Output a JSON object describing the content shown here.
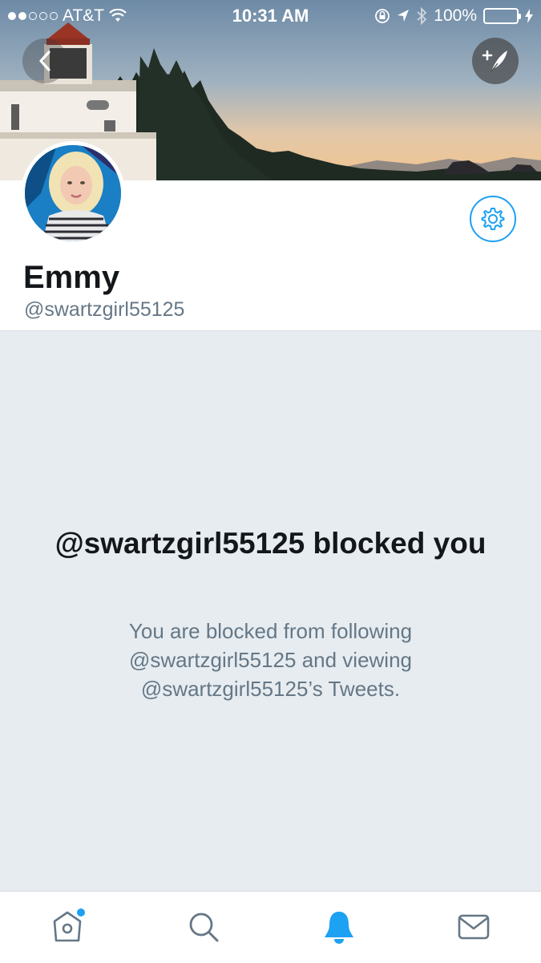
{
  "status_bar": {
    "carrier": "AT&T",
    "time": "10:31 AM",
    "battery": "100%",
    "signal_bars_filled": 2,
    "signal_bars_total": 5
  },
  "header": {
    "back_icon": "chevron-left-icon",
    "compose_icon": "compose-tweet-icon"
  },
  "profile": {
    "display_name": "Emmy",
    "handle": "@swartzgirl55125",
    "settings_icon": "gear-icon"
  },
  "blocked": {
    "title": "@swartzgirl55125 blocked you",
    "description": "You are blocked from following @swartzgirl55125 and viewing @swartzgirl55125’s Tweets."
  },
  "tab_bar": {
    "items": [
      {
        "name": "home",
        "icon": "home-icon",
        "has_badge": true
      },
      {
        "name": "search",
        "icon": "search-icon",
        "has_badge": false
      },
      {
        "name": "notifications",
        "icon": "bell-icon",
        "active": true
      },
      {
        "name": "messages",
        "icon": "mail-icon",
        "has_badge": false
      }
    ],
    "active_color": "#1da1f2",
    "inactive_color": "#657786"
  }
}
